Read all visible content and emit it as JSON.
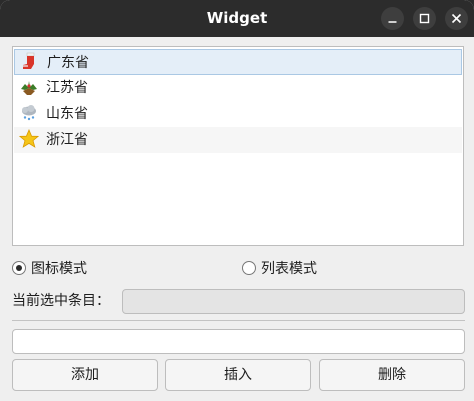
{
  "window": {
    "title": "Widget"
  },
  "list": {
    "items": [
      {
        "label": "广东省",
        "icon": "christmas-stocking-icon",
        "selected": true
      },
      {
        "label": "江苏省",
        "icon": "holly-icon",
        "selected": false
      },
      {
        "label": "山东省",
        "icon": "snow-cloud-icon",
        "selected": false
      },
      {
        "label": "浙江省",
        "icon": "star-icon",
        "selected": false
      }
    ]
  },
  "mode": {
    "icon_mode_label": "图标模式",
    "list_mode_label": "列表模式",
    "selected": "icon_mode"
  },
  "current": {
    "label": "当前选中条目：",
    "value": ""
  },
  "input": {
    "value": ""
  },
  "buttons": {
    "add": "添加",
    "insert": "插入",
    "delete": "删除"
  }
}
